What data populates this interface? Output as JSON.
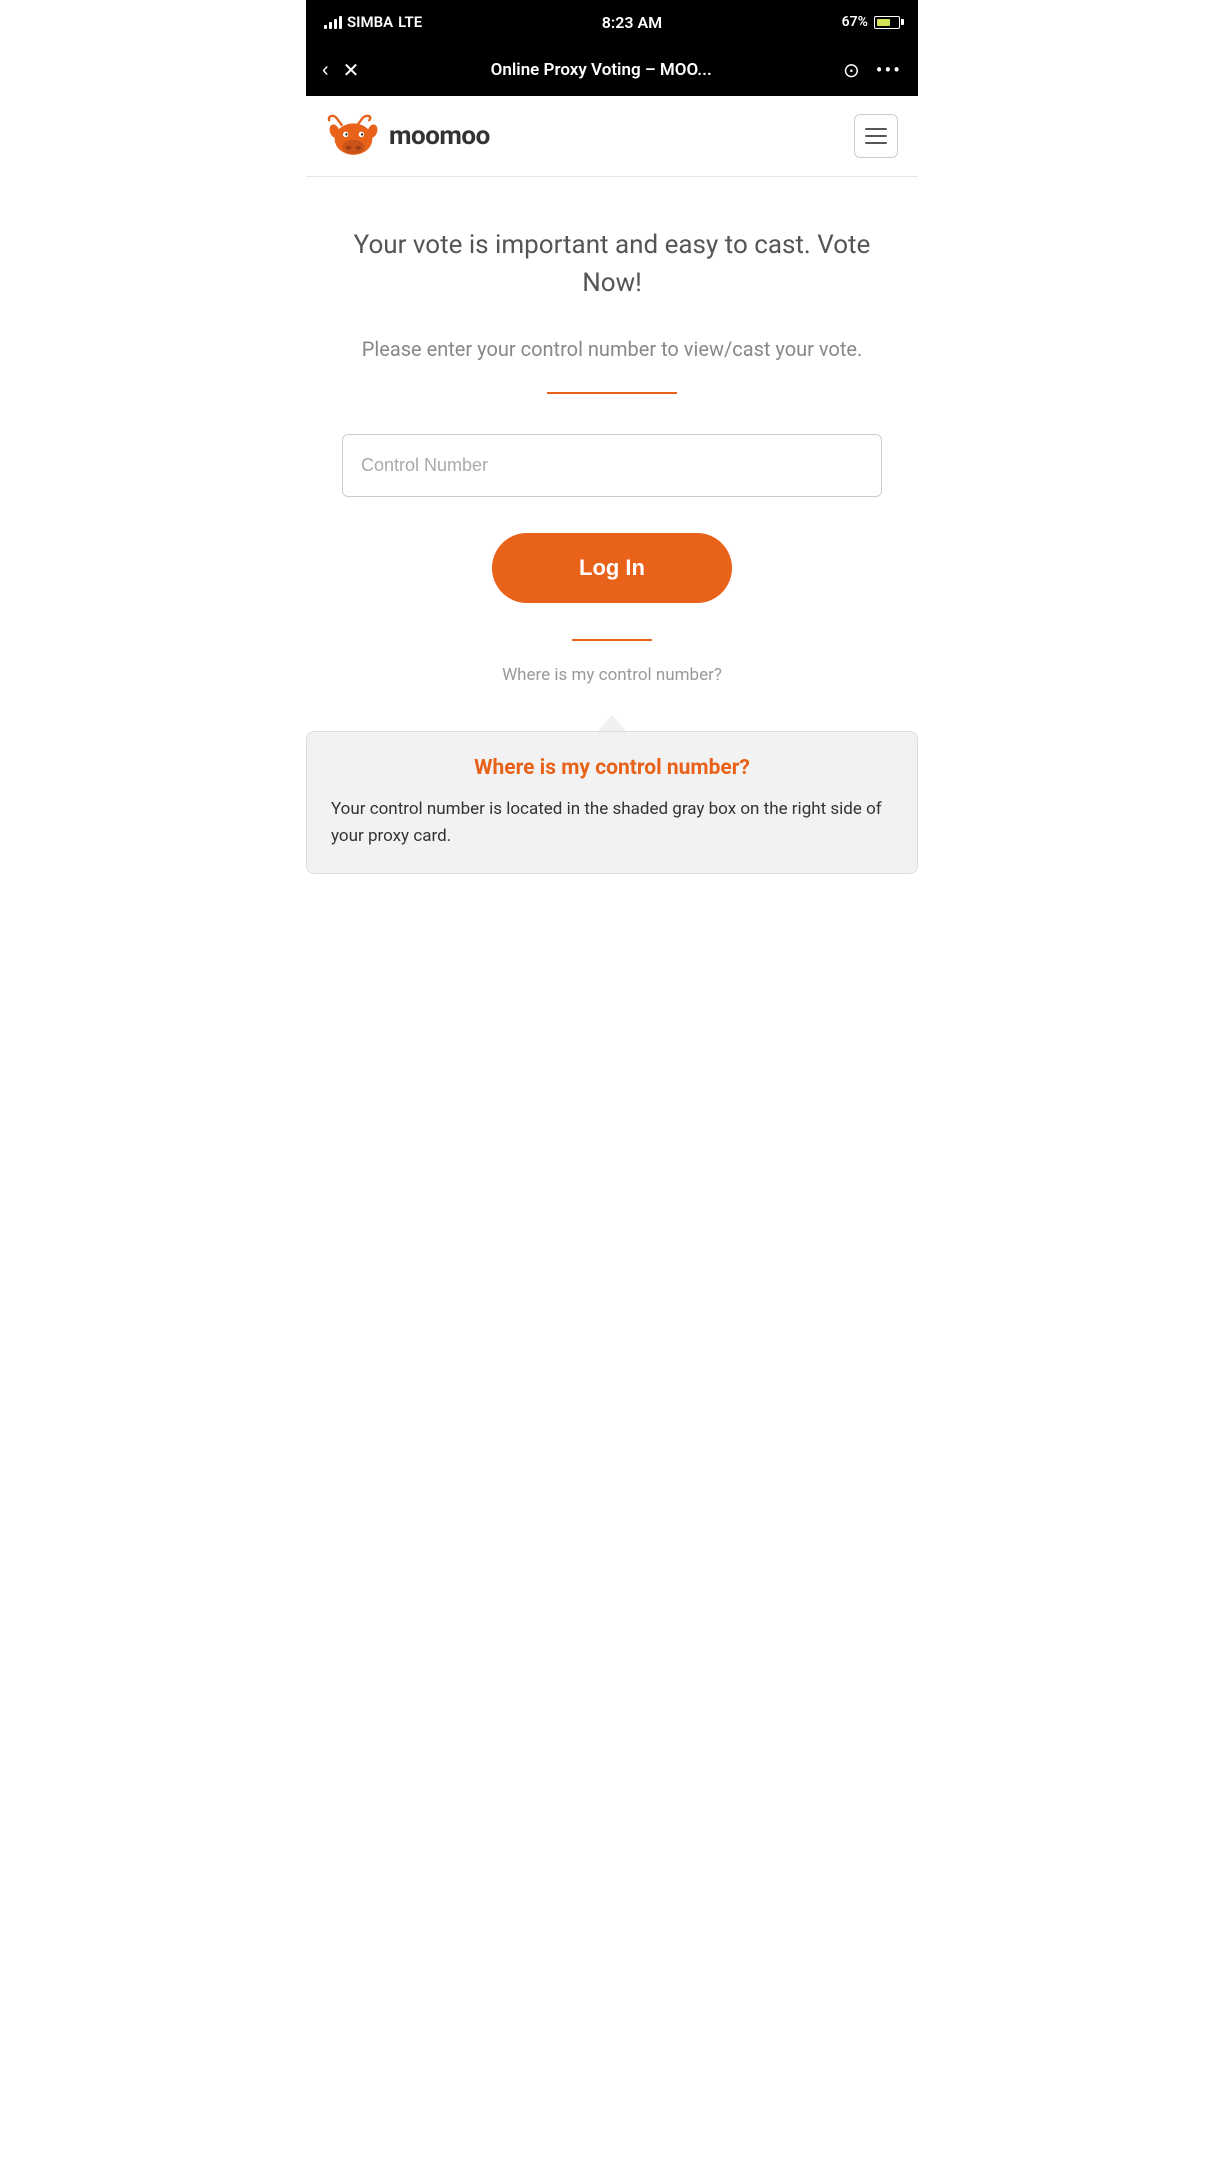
{
  "statusBar": {
    "carrier": "SIMBA",
    "network": "LTE",
    "time": "8:23 AM",
    "battery": "67%"
  },
  "browserNav": {
    "title": "Online Proxy Voting – MOO...",
    "backLabel": "‹",
    "closeLabel": "✕",
    "searchLabel": "○",
    "moreLabel": "•••"
  },
  "header": {
    "logoText": "moomoo",
    "menuLabel": "☰"
  },
  "main": {
    "headline": "Your vote is important and easy to cast. Vote Now!",
    "subtitle": "Please enter your control number to view/cast your vote.",
    "controlNumberPlaceholder": "Control Number",
    "loginButtonLabel": "Log In",
    "whereLinkText": "Where is my control number?"
  },
  "infoPanel": {
    "title": "Where is my control number?",
    "body": "Your control number is located in the shaded gray box on the right side of your proxy card."
  }
}
